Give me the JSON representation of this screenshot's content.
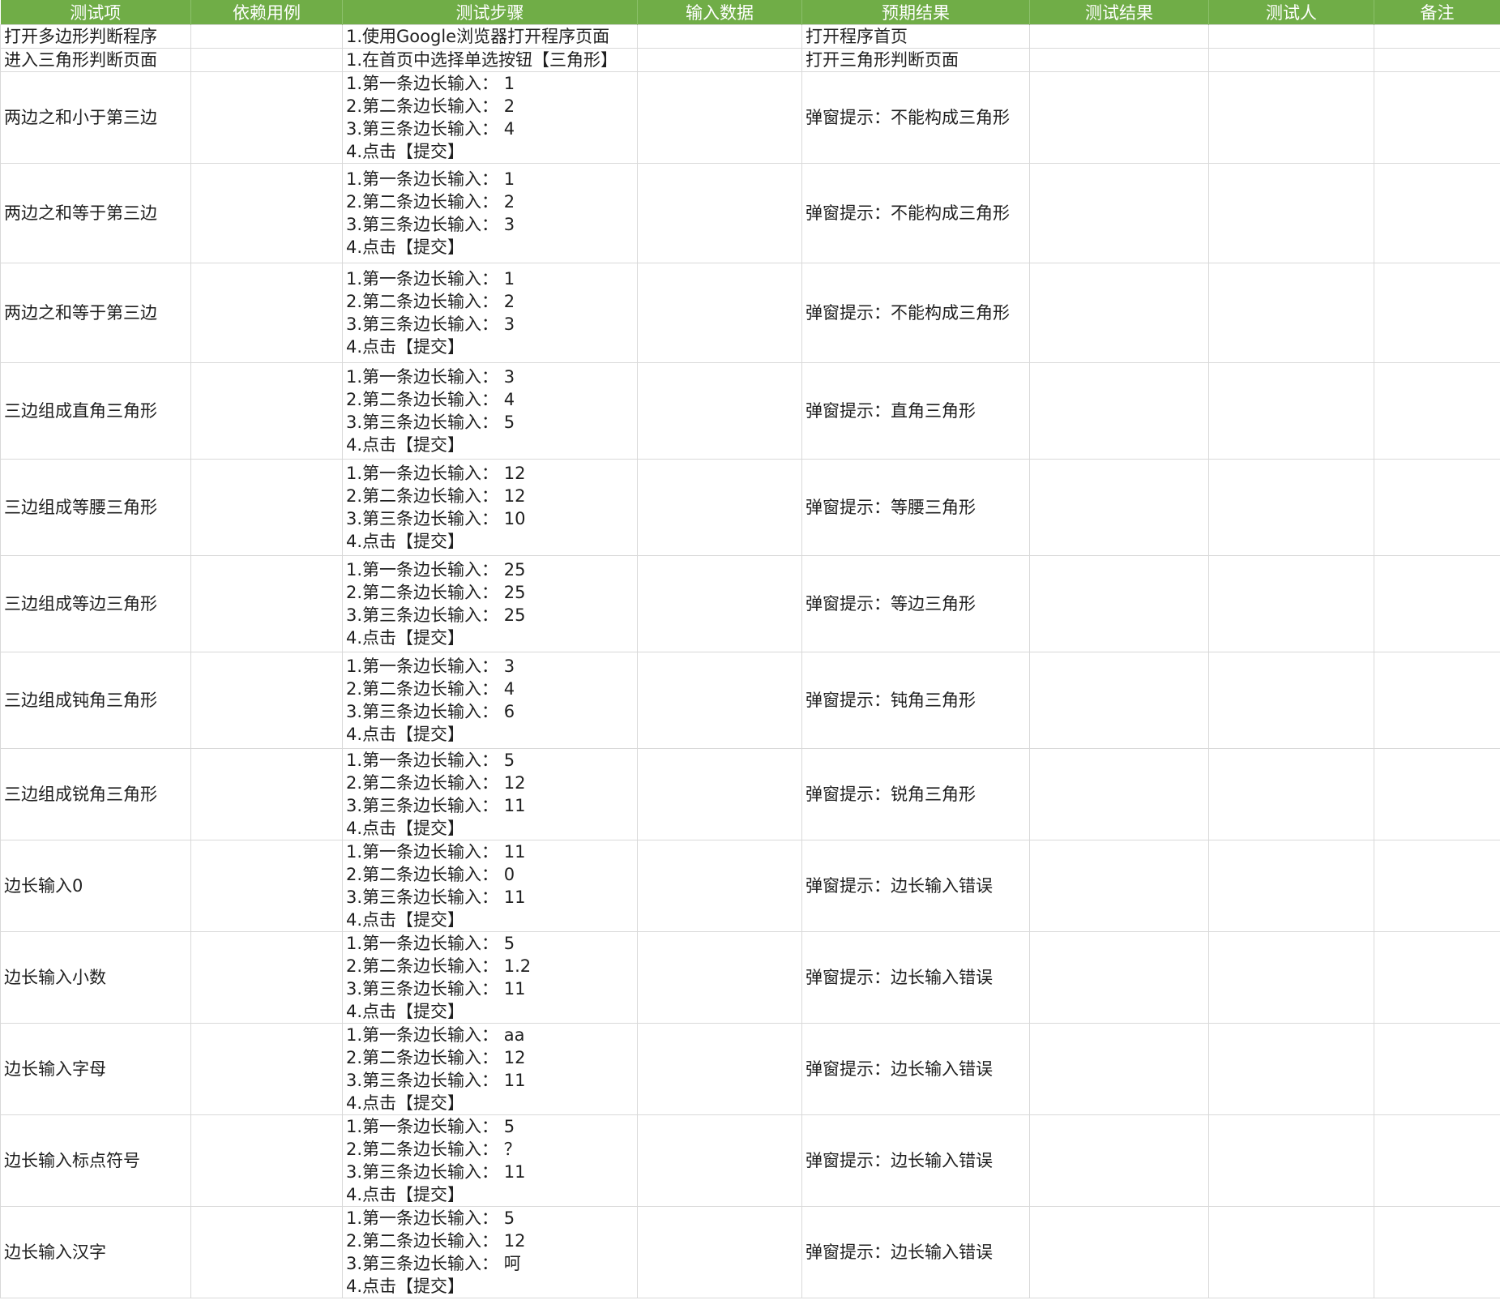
{
  "sheet": {
    "headers": [
      "测试项",
      "依赖用例",
      "测试步骤",
      "输入数据",
      "预期结果",
      "测试结果",
      "测试人",
      "备注"
    ],
    "rows": [
      {
        "item": "打开多边形判断程序",
        "dependency": "",
        "steps": [
          "1.使用Google浏览器打开程序页面"
        ],
        "input": "",
        "expected": "打开程序首页",
        "result": "",
        "tester": "",
        "notes": ""
      },
      {
        "item": "进入三角形判断页面",
        "dependency": "",
        "steps": [
          "1.在首页中选择单选按钮【三角形】"
        ],
        "input": "",
        "expected": "打开三角形判断页面",
        "result": "",
        "tester": "",
        "notes": ""
      },
      {
        "item": "两边之和小于第三边",
        "dependency": "",
        "steps": [
          "1.第一条边长输入：  1",
          "2.第二条边长输入：  2",
          "3.第三条边长输入：  4",
          "4.点击【提交】"
        ],
        "input": "",
        "expected": "弹窗提示：不能构成三角形",
        "result": "",
        "tester": "",
        "notes": ""
      },
      {
        "item": "两边之和等于第三边",
        "dependency": "",
        "steps": [
          "1.第一条边长输入：  1",
          "2.第二条边长输入：  2",
          "3.第三条边长输入：  3",
          "4.点击【提交】"
        ],
        "input": "",
        "expected": "弹窗提示：不能构成三角形",
        "result": "",
        "tester": "",
        "notes": ""
      },
      {
        "item": "两边之和等于第三边",
        "dependency": "",
        "steps": [
          "1.第一条边长输入：  1",
          "2.第二条边长输入：  2",
          "3.第三条边长输入：  3",
          "4.点击【提交】"
        ],
        "input": "",
        "expected": "弹窗提示：不能构成三角形",
        "result": "",
        "tester": "",
        "notes": ""
      },
      {
        "item": "三边组成直角三角形",
        "dependency": "",
        "steps": [
          "1.第一条边长输入：  3",
          "2.第二条边长输入：  4",
          "3.第三条边长输入：  5",
          "4.点击【提交】"
        ],
        "input": "",
        "expected": "弹窗提示：直角三角形",
        "result": "",
        "tester": "",
        "notes": ""
      },
      {
        "item": "三边组成等腰三角形",
        "dependency": "",
        "steps": [
          "1.第一条边长输入：  12",
          "2.第二条边长输入：  12",
          "3.第三条边长输入：  10",
          "4.点击【提交】"
        ],
        "input": "",
        "expected": "弹窗提示：等腰三角形",
        "result": "",
        "tester": "",
        "notes": ""
      },
      {
        "item": "三边组成等边三角形",
        "dependency": "",
        "steps": [
          "1.第一条边长输入：  25",
          "2.第二条边长输入：  25",
          "3.第三条边长输入：  25",
          "4.点击【提交】"
        ],
        "input": "",
        "expected": "弹窗提示：等边三角形",
        "result": "",
        "tester": "",
        "notes": ""
      },
      {
        "item": "三边组成钝角三角形",
        "dependency": "",
        "steps": [
          "1.第一条边长输入：  3",
          "2.第二条边长输入：  4",
          "3.第三条边长输入：  6",
          "4.点击【提交】"
        ],
        "input": "",
        "expected": "弹窗提示：钝角三角形",
        "result": "",
        "tester": "",
        "notes": ""
      },
      {
        "item": "三边组成锐角三角形",
        "dependency": "",
        "steps": [
          "1.第一条边长输入：  5",
          "2.第二条边长输入：  12",
          "3.第三条边长输入：  11",
          "4.点击【提交】"
        ],
        "input": "",
        "expected": "弹窗提示：锐角三角形",
        "result": "",
        "tester": "",
        "notes": ""
      },
      {
        "item": "边长输入0",
        "dependency": "",
        "steps": [
          "1.第一条边长输入：  11",
          "2.第二条边长输入：  0",
          "3.第三条边长输入：  11",
          "4.点击【提交】"
        ],
        "input": "",
        "expected": "弹窗提示：边长输入错误",
        "result": "",
        "tester": "",
        "notes": ""
      },
      {
        "item": "边长输入小数",
        "dependency": "",
        "steps": [
          "1.第一条边长输入：  5",
          "2.第二条边长输入：  1.2",
          "3.第三条边长输入：  11",
          "4.点击【提交】"
        ],
        "input": "",
        "expected": "弹窗提示：边长输入错误",
        "result": "",
        "tester": "",
        "notes": ""
      },
      {
        "item": "边长输入字母",
        "dependency": "",
        "steps": [
          "1.第一条边长输入：  aa",
          "2.第二条边长输入：  12",
          "3.第三条边长输入：  11",
          "4.点击【提交】"
        ],
        "input": "",
        "expected": "弹窗提示：边长输入错误",
        "result": "",
        "tester": "",
        "notes": ""
      },
      {
        "item": "边长输入标点符号",
        "dependency": "",
        "steps": [
          "1.第一条边长输入：  5",
          "2.第二条边长输入：  ？",
          "3.第三条边长输入：  11",
          "4.点击【提交】"
        ],
        "input": "",
        "expected": "弹窗提示：边长输入错误",
        "result": "",
        "tester": "",
        "notes": ""
      },
      {
        "item": "边长输入汉字",
        "dependency": "",
        "steps": [
          "1.第一条边长输入：  5",
          "2.第二条边长输入：  12",
          "3.第三条边长输入：  呵",
          "4.点击【提交】"
        ],
        "input": "",
        "expected": "弹窗提示：边长输入错误",
        "result": "",
        "tester": "",
        "notes": ""
      }
    ]
  },
  "colors": {
    "header_bg": "#70ad47",
    "header_text": "#ffffff",
    "gridline": "#d9d9d9"
  }
}
